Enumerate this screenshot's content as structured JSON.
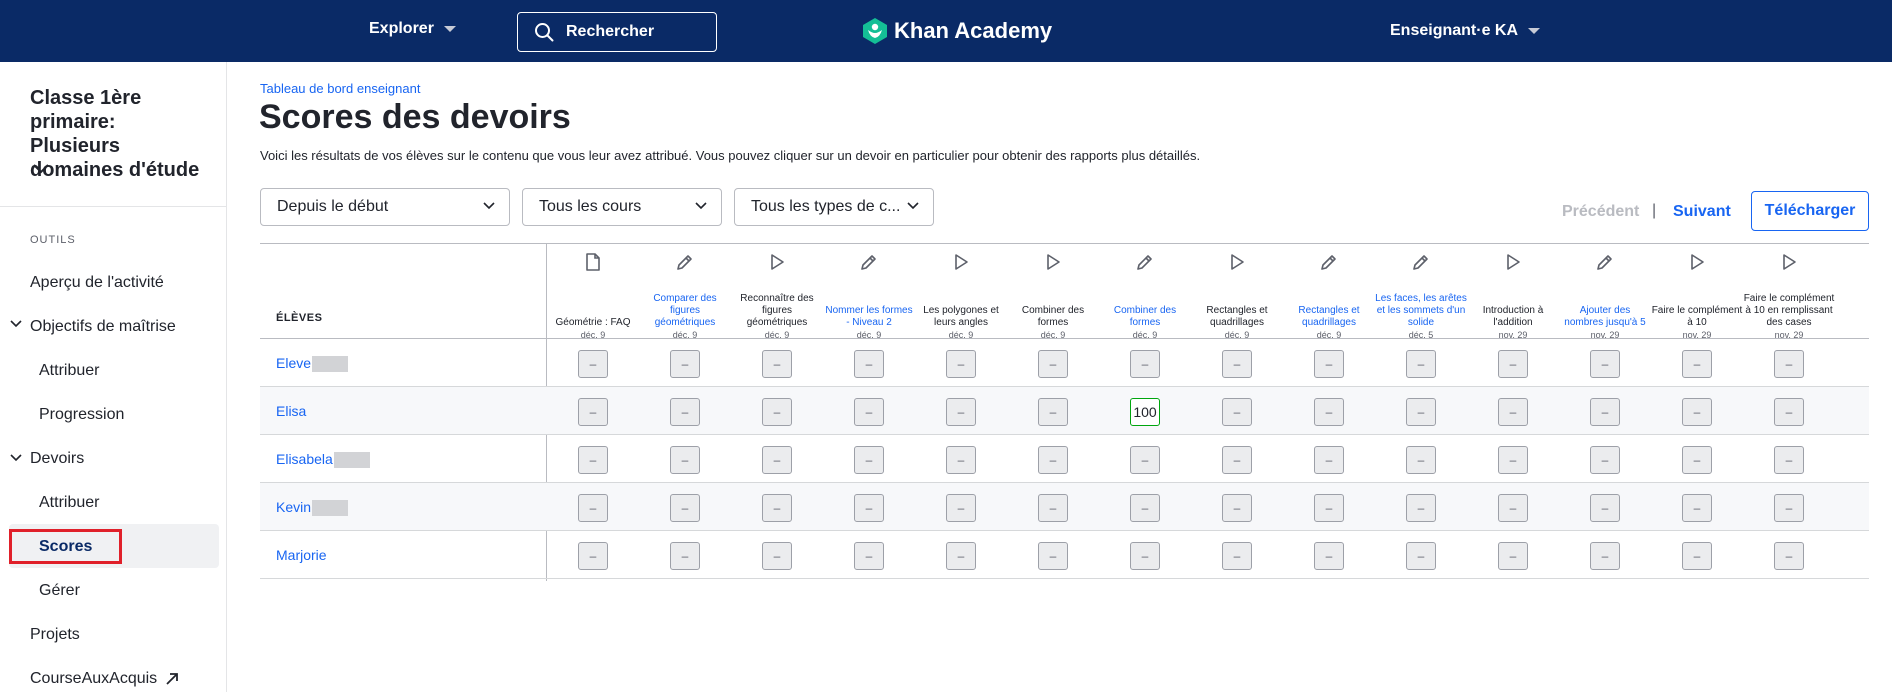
{
  "topbar": {
    "explore": "Explorer",
    "search_placeholder": "Rechercher",
    "brand": "Khan Academy",
    "account": "Enseignant·e KA"
  },
  "sidebar": {
    "class_title": "Classe 1ère primaire: Plusieurs domaines d'étude",
    "tools_label": "OUTILS",
    "items": [
      {
        "label": "Aperçu de l'activité"
      },
      {
        "label": "Objectifs de maîtrise"
      },
      {
        "label": "Attribuer"
      },
      {
        "label": "Progression"
      },
      {
        "label": "Devoirs"
      },
      {
        "label": "Attribuer"
      },
      {
        "label": "Scores"
      },
      {
        "label": "Gérer"
      },
      {
        "label": "Projets"
      },
      {
        "label": "CourseAuxAcquis"
      }
    ]
  },
  "main": {
    "breadcrumb": "Tableau de bord enseignant",
    "title": "Scores des devoirs",
    "description": "Voici les résultats de vos élèves sur le contenu que vous leur avez attribué. Vous pouvez cliquer sur un devoir en particulier pour obtenir des rapports plus détaillés.",
    "filters": {
      "date": "Depuis le début",
      "course": "Tous les cours",
      "type": "Tous les types de c..."
    },
    "pagination": {
      "previous": "Précédent",
      "separator": "|",
      "next": "Suivant"
    },
    "download": "Télécharger"
  },
  "table": {
    "students_header": "ÉLÈVES",
    "columns": [
      {
        "name": "Géométrie : FAQ",
        "date": "déc. 9",
        "icon": "article-icon",
        "link": false
      },
      {
        "name": "Comparer des figures géométriques",
        "date": "déc. 9",
        "icon": "pencil-icon",
        "link": true
      },
      {
        "name": "Reconnaître des figures géométriques",
        "date": "déc. 9",
        "icon": "play-icon",
        "link": false
      },
      {
        "name": "Nommer les formes - Niveau 2",
        "date": "déc. 9",
        "icon": "pencil-icon",
        "link": true
      },
      {
        "name": "Les polygones et leurs angles",
        "date": "déc. 9",
        "icon": "play-icon",
        "link": false
      },
      {
        "name": "Combiner des formes",
        "date": "déc. 9",
        "icon": "play-icon",
        "link": false
      },
      {
        "name": "Combiner des formes",
        "date": "déc. 9",
        "icon": "pencil-icon",
        "link": true
      },
      {
        "name": "Rectangles et quadrillages",
        "date": "déc. 9",
        "icon": "play-icon",
        "link": false
      },
      {
        "name": "Rectangles et quadrillages",
        "date": "déc. 9",
        "icon": "pencil-icon",
        "link": true
      },
      {
        "name": "Les faces, les arêtes et les sommets d'un solide",
        "date": "déc. 5",
        "icon": "pencil-icon",
        "link": true
      },
      {
        "name": "Introduction à l'addition",
        "date": "nov. 29",
        "icon": "play-icon",
        "link": false
      },
      {
        "name": "Ajouter des nombres jusqu'à 5",
        "date": "nov. 29",
        "icon": "pencil-icon",
        "link": true
      },
      {
        "name": "Faire le complément à 10",
        "date": "nov. 29",
        "icon": "play-icon",
        "link": false
      },
      {
        "name": "Faire le complément à 10 en remplissant des cases",
        "date": "nov. 29",
        "icon": "play-icon",
        "link": false
      }
    ],
    "rows": [
      {
        "student": "Eleve",
        "scores": [
          "–",
          "–",
          "–",
          "–",
          "–",
          "–",
          "–",
          "–",
          "–",
          "–",
          "–",
          "–",
          "–",
          "–"
        ]
      },
      {
        "student": "Elisa",
        "scores": [
          "–",
          "–",
          "–",
          "–",
          "–",
          "–",
          "100",
          "–",
          "–",
          "–",
          "–",
          "–",
          "–",
          "–"
        ]
      },
      {
        "student": "Elisabela",
        "scores": [
          "–",
          "–",
          "–",
          "–",
          "–",
          "–",
          "–",
          "–",
          "–",
          "–",
          "–",
          "–",
          "–",
          "–"
        ]
      },
      {
        "student": "Kevin",
        "scores": [
          "–",
          "–",
          "–",
          "–",
          "–",
          "–",
          "–",
          "–",
          "–",
          "–",
          "–",
          "–",
          "–",
          "–"
        ]
      },
      {
        "student": "Marjorie",
        "scores": [
          "–",
          "–",
          "–",
          "–",
          "–",
          "–",
          "–",
          "–",
          "–",
          "–",
          "–",
          "–",
          "–",
          "–"
        ]
      }
    ],
    "colors": {
      "link": "#1865f2",
      "score_border": "#00a60e",
      "highlight": "#e0202a"
    }
  }
}
